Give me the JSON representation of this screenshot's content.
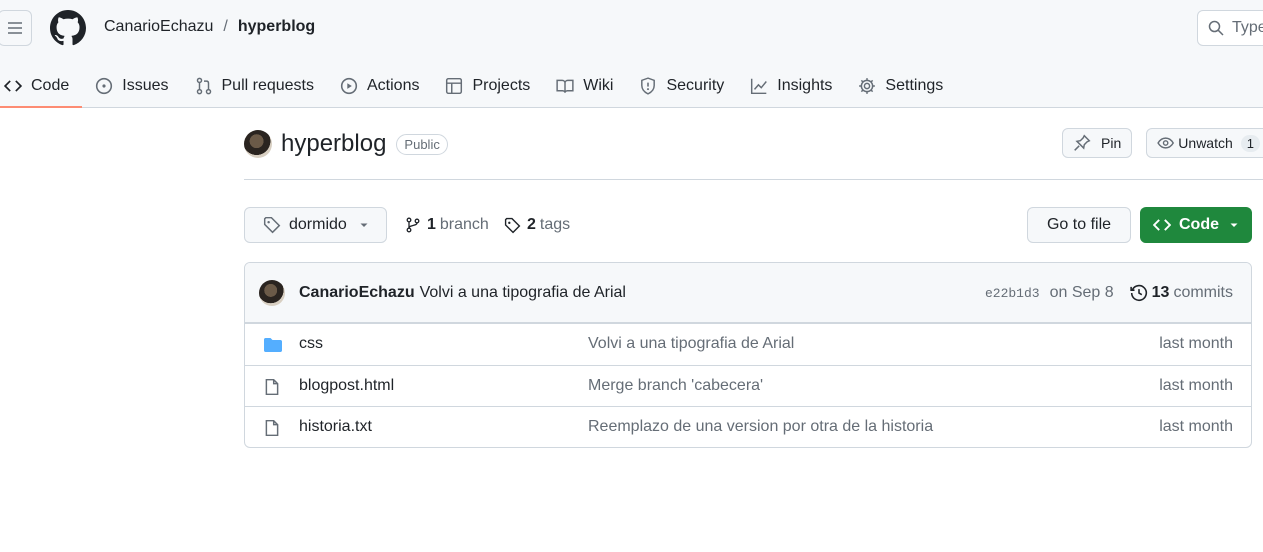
{
  "header": {
    "owner": "CanarioEchazu",
    "separator": "/",
    "repo": "hyperblog",
    "search_placeholder": "Type"
  },
  "tabs": [
    {
      "label": "Code",
      "icon": "code-icon",
      "active": true
    },
    {
      "label": "Issues",
      "icon": "issue-icon"
    },
    {
      "label": "Pull requests",
      "icon": "pull-request-icon"
    },
    {
      "label": "Actions",
      "icon": "play-icon"
    },
    {
      "label": "Projects",
      "icon": "table-icon"
    },
    {
      "label": "Wiki",
      "icon": "book-icon"
    },
    {
      "label": "Security",
      "icon": "shield-icon"
    },
    {
      "label": "Insights",
      "icon": "graph-icon"
    },
    {
      "label": "Settings",
      "icon": "gear-icon"
    }
  ],
  "repo": {
    "name": "hyperblog",
    "visibility": "Public",
    "pin_label": "Pin",
    "unwatch_label": "Unwatch",
    "watch_count": "1"
  },
  "toolbar": {
    "branch": "dormido",
    "branch_count": "1",
    "branch_label": "branch",
    "tag_count": "2",
    "tag_label": "tags",
    "go_to_file": "Go to file",
    "code_label": "Code"
  },
  "latest_commit": {
    "author": "CanarioEchazu",
    "message": "Volvi a una tipografia de Arial",
    "sha": "e22b1d3",
    "date": "on Sep 8",
    "commit_count": "13",
    "commit_label": "commits"
  },
  "files": [
    {
      "type": "folder",
      "name": "css",
      "message": "Volvi a una tipografia de Arial",
      "age": "last month"
    },
    {
      "type": "file",
      "name": "blogpost.html",
      "message": "Merge branch 'cabecera'",
      "age": "last month"
    },
    {
      "type": "file",
      "name": "historia.txt",
      "message": "Reemplazo de una version por otra de la historia",
      "age": "last month"
    }
  ],
  "colors": {
    "accent_green": "#1f883d",
    "active_tab_underline": "#fd8c73",
    "folder_blue": "#54aeff"
  }
}
